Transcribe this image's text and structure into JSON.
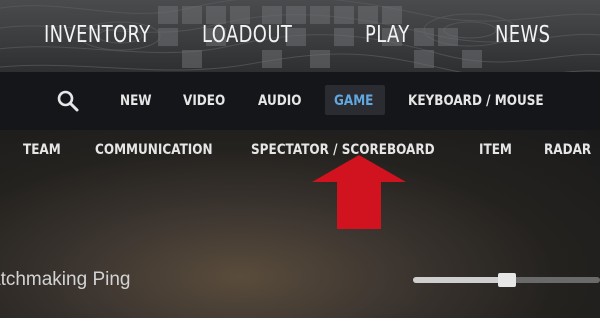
{
  "main_nav": {
    "items": [
      {
        "label": "INVENTORY"
      },
      {
        "label": "LOADOUT"
      },
      {
        "label": "PLAY"
      },
      {
        "label": "NEWS"
      }
    ]
  },
  "settings_nav": {
    "search_icon": "search-icon",
    "items": [
      {
        "label": "NEW"
      },
      {
        "label": "VIDEO"
      },
      {
        "label": "AUDIO"
      },
      {
        "label": "GAME",
        "active": true
      },
      {
        "label": "KEYBOARD / MOUSE"
      }
    ],
    "active_color": "#62a8e0"
  },
  "game_tabs": {
    "items": [
      {
        "label": "TEAM"
      },
      {
        "label": "COMMUNICATION"
      },
      {
        "label": "SPECTATOR / SCOREBOARD"
      },
      {
        "label": "ITEM"
      },
      {
        "label": "RADAR"
      }
    ]
  },
  "settings": [
    {
      "label": "atchmaking Ping",
      "slider_fraction": 0.5
    }
  ],
  "annotation": {
    "shape": "arrow-up",
    "color": "#d0131f"
  }
}
